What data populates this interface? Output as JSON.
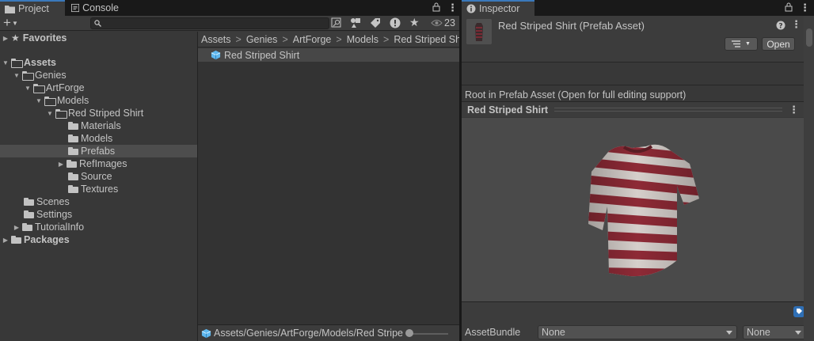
{
  "tabs": {
    "project": "Project",
    "console": "Console",
    "inspector": "Inspector"
  },
  "toolbar": {
    "add_label": "+",
    "hidden_count": "23",
    "search_placeholder": ""
  },
  "tree": {
    "favorites": "Favorites",
    "assets": "Assets",
    "genies": "Genies",
    "artforge": "ArtForge",
    "models": "Models",
    "red_striped_shirt": "Red Striped Shirt",
    "materials": "Materials",
    "models_sub": "Models",
    "prefabs": "Prefabs",
    "refimages": "RefImages",
    "source": "Source",
    "textures": "Textures",
    "scenes": "Scenes",
    "settings": "Settings",
    "tutorialinfo": "TutorialInfo",
    "packages": "Packages"
  },
  "breadcrumb": {
    "items": [
      "Assets",
      "Genies",
      "ArtForge",
      "Models",
      "Red Striped Shirt"
    ]
  },
  "files": {
    "item": "Red Striped Shirt",
    "status_path": "Assets/Genies/ArtForge/Models/Red Stripe"
  },
  "inspector": {
    "title": "Red Striped Shirt (Prefab Asset)",
    "open_label": "Open",
    "root_message": "Root in Prefab Asset (Open for full editing support)",
    "preview_title": "Red Striped Shirt",
    "assetbundle_label": "AssetBundle",
    "assetbundle_value": "None",
    "variant_value": "None"
  },
  "colors": {
    "accent": "#3a79bb",
    "shirt_red": "#8e2a36",
    "shirt_white": "#d6cfcb"
  }
}
